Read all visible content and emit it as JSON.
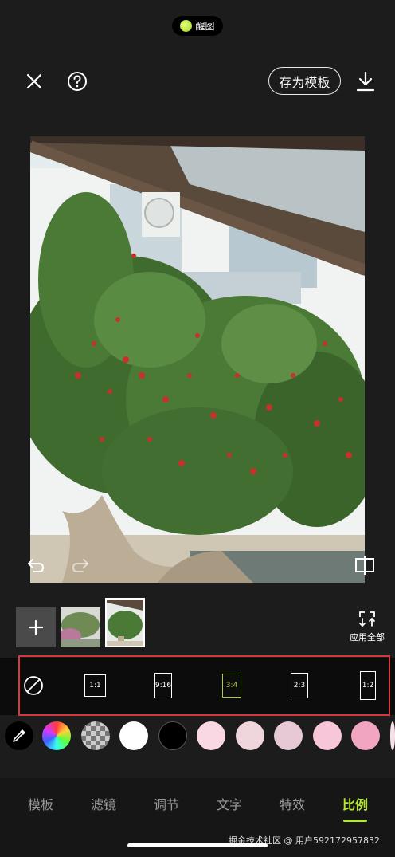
{
  "status": {
    "label": "醒图"
  },
  "toolbar": {
    "close_icon": "close-icon",
    "help_icon": "help-icon",
    "save_template_label": "存为模板",
    "download_icon": "download-icon"
  },
  "canvas": {
    "undo_icon": "undo-icon",
    "redo_icon": "redo-icon",
    "compare_icon": "compare-icon"
  },
  "thumbnails": {
    "add_icon": "plus-icon",
    "apply_all_label": "应用全部"
  },
  "ratios": {
    "selected": "3:4",
    "items": [
      {
        "label": "1:1"
      },
      {
        "label": "9:16"
      },
      {
        "label": "3:4"
      },
      {
        "label": "2:3"
      },
      {
        "label": "1:2"
      }
    ]
  },
  "colors": {
    "swatches": [
      "#ffffff",
      "#000000",
      "#f9d8e3",
      "#eed6dc",
      "#e7c9d5",
      "#f7c6d8",
      "#f2a5c1",
      "#f8e2ea"
    ]
  },
  "tabs": {
    "items": [
      {
        "label": "模板"
      },
      {
        "label": "滤镜"
      },
      {
        "label": "调节"
      },
      {
        "label": "文字"
      },
      {
        "label": "特效"
      },
      {
        "label": "比例"
      }
    ],
    "active": "比例"
  },
  "watermark": "掘金技术社区 @ 用户592172957832",
  "accent_color": "#b6e62d"
}
